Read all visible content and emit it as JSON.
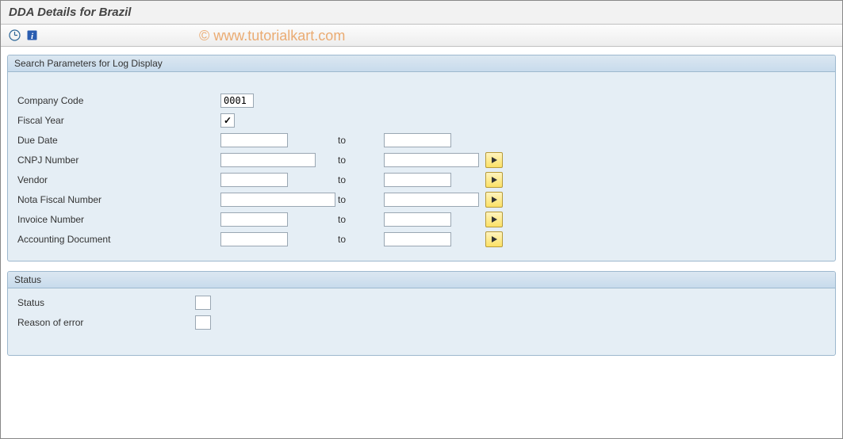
{
  "title": "DDA Details for Brazil",
  "watermark": "© www.tutorialkart.com",
  "groups": {
    "search": {
      "title": "Search Parameters for Log Display",
      "rows": {
        "company_code": {
          "label": "Company Code",
          "value": "0001"
        },
        "fiscal_year": {
          "label": "Fiscal Year",
          "checked": true
        },
        "due_date": {
          "label": "Due Date",
          "from": "",
          "to_label": "to",
          "to": ""
        },
        "cnpj_number": {
          "label": "CNPJ Number",
          "from": "",
          "to_label": "to",
          "to": ""
        },
        "vendor": {
          "label": "Vendor",
          "from": "",
          "to_label": "to",
          "to": ""
        },
        "nota_fiscal_number": {
          "label": "Nota Fiscal Number",
          "from": "",
          "to_label": "to",
          "to": ""
        },
        "invoice_number": {
          "label": "Invoice Number",
          "from": "",
          "to_label": "to",
          "to": ""
        },
        "accounting_document": {
          "label": "Accounting Document",
          "from": "",
          "to_label": "to",
          "to": ""
        }
      }
    },
    "status": {
      "title": "Status",
      "rows": {
        "status": {
          "label": "Status",
          "value": ""
        },
        "reason_of_error": {
          "label": "Reason of error",
          "value": ""
        }
      }
    }
  }
}
